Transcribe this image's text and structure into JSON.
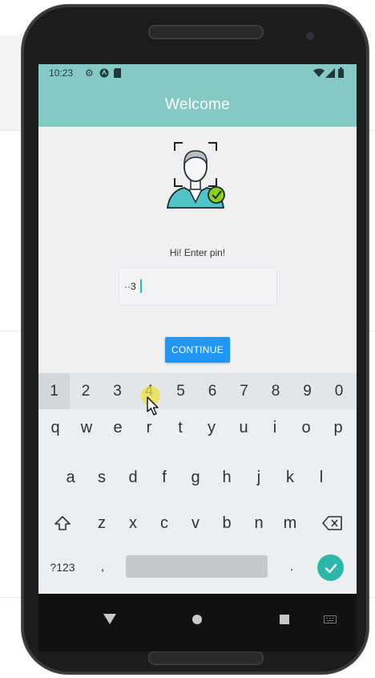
{
  "status_bar": {
    "time": "10:23",
    "icons": [
      "gear-icon",
      "android-icon",
      "sd-card-icon",
      "wifi-icon",
      "signal-icon",
      "battery-icon"
    ]
  },
  "app_bar": {
    "title": "Welcome"
  },
  "prompt": "Hi! Enter pin!",
  "pin_input": {
    "value": "··3"
  },
  "continue_label": "CONTINUE",
  "keyboard": {
    "number_row": [
      "1",
      "2",
      "3",
      "4",
      "5",
      "6",
      "7",
      "8",
      "9",
      "0"
    ],
    "row1": [
      "q",
      "w",
      "e",
      "r",
      "t",
      "y",
      "u",
      "i",
      "o",
      "p"
    ],
    "row2": [
      "a",
      "s",
      "d",
      "f",
      "g",
      "h",
      "j",
      "k",
      "l"
    ],
    "row3": [
      "z",
      "x",
      "c",
      "v",
      "b",
      "n",
      "m"
    ],
    "symbols_label": "?123",
    "comma": ",",
    "period": ".",
    "pressed_key": "1",
    "hovered_key": "4"
  },
  "colors": {
    "app_bar": "#86c9c4",
    "accent": "#2bb8a9",
    "button": "#2196f3"
  }
}
